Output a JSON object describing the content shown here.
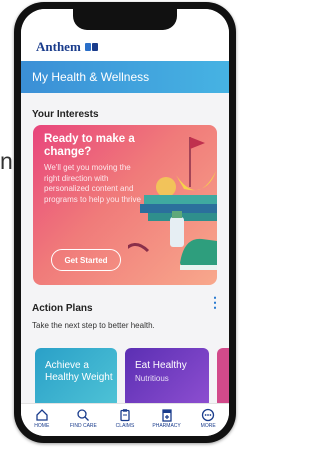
{
  "peek_text": "n",
  "brand": {
    "name": "Anthem"
  },
  "header": {
    "title": "My Health & Wellness"
  },
  "interests": {
    "title": "Your Interests",
    "hero": {
      "title": "Ready to make a change?",
      "body": "We'll get you moving the right direction with personalized content and programs to help you thrive",
      "button": "Get Started"
    }
  },
  "plans": {
    "title": "Action Plans",
    "subtitle": "Take the next step to better health.",
    "cards": [
      {
        "title": "Achieve a Healthy Weight",
        "subtitle": ""
      },
      {
        "title": "Eat Healthy",
        "subtitle": "Nutritious"
      }
    ]
  },
  "tabs": [
    {
      "label": "HOME",
      "icon": "home-icon"
    },
    {
      "label": "FIND CARE",
      "icon": "search-icon"
    },
    {
      "label": "CLAIMS",
      "icon": "clipboard-icon"
    },
    {
      "label": "PHARMACY",
      "icon": "pharmacy-icon"
    },
    {
      "label": "MORE",
      "icon": "more-icon"
    }
  ],
  "colors": {
    "brand": "#1a3c8c",
    "header_gradient": [
      "#3b8fd6",
      "#46b3e3"
    ],
    "hero_gradient": [
      "#e8457c",
      "#f8a88c"
    ],
    "card1": "#2aa0c8",
    "card2": "#7a3fc4"
  }
}
